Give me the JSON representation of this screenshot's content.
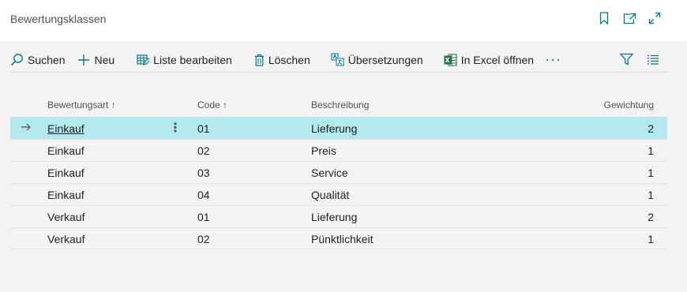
{
  "page": {
    "title": "Bewertungsklassen"
  },
  "title_icons": [
    "bookmark-icon",
    "open-in-new-window-icon",
    "expand-icon"
  ],
  "toolbar": {
    "search_label": "Suchen",
    "new_label": "Neu",
    "edit_list_label": "Liste bearbeiten",
    "delete_label": "Löschen",
    "translations_label": "Übersetzungen",
    "excel_label": "In Excel öffnen",
    "more_label": "···"
  },
  "table": {
    "headers": {
      "art": "Bewertungsart ↑",
      "code": "Code ↑",
      "desc": "Beschreibung",
      "weight": "Gewichtung"
    },
    "rows": [
      {
        "art": "Einkauf",
        "code": "01",
        "desc": "Lieferung",
        "weight": "2"
      },
      {
        "art": "Einkauf",
        "code": "02",
        "desc": "Preis",
        "weight": "1"
      },
      {
        "art": "Einkauf",
        "code": "03",
        "desc": "Service",
        "weight": "1"
      },
      {
        "art": "Einkauf",
        "code": "04",
        "desc": "Qualität",
        "weight": "1"
      },
      {
        "art": "Verkauf",
        "code": "01",
        "desc": "Lieferung",
        "weight": "2"
      },
      {
        "art": "Verkauf",
        "code": "02",
        "desc": "Pünktlichkeit",
        "weight": "1"
      }
    ],
    "selected_row": 0
  },
  "colors": {
    "accent": "#00798a",
    "selected_row": "#b2e8ee",
    "excel_green": "#1e7145"
  }
}
